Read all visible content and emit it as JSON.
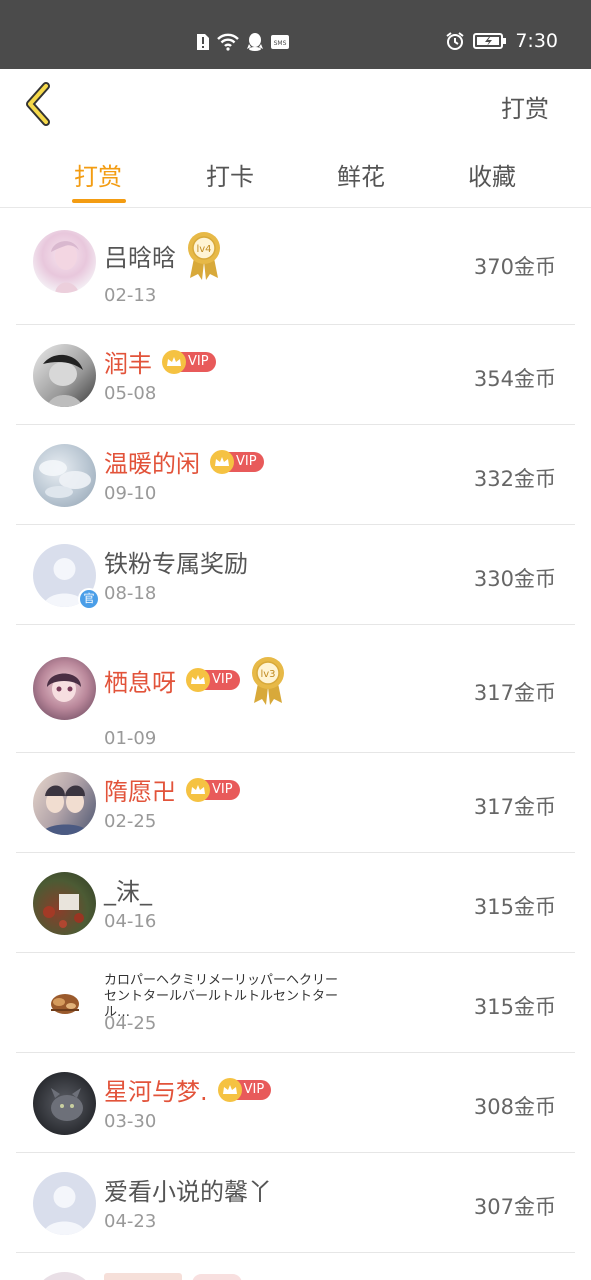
{
  "status_bar": {
    "time": "7:30",
    "left_icons": [
      "sim-alert-icon",
      "wifi-icon",
      "qq-icon",
      "sms-icon"
    ],
    "sms_text": "SMS",
    "right_icons": [
      "alarm-icon",
      "battery-icon"
    ]
  },
  "nav": {
    "back_icon": "chevron-left-icon",
    "action_label": "打赏"
  },
  "tabs": [
    {
      "label": "打赏",
      "active": true
    },
    {
      "label": "打卡",
      "active": false
    },
    {
      "label": "鲜花",
      "active": false
    },
    {
      "label": "收藏",
      "active": false
    }
  ],
  "badges": {
    "vip_label": "VIP",
    "official_label": "官"
  },
  "list": [
    {
      "name": "吕晗晗",
      "date": "02-13",
      "amount": "370金币",
      "vip": false,
      "medal": "lv4"
    },
    {
      "name": "润丰",
      "date": "05-08",
      "amount": "354金币",
      "vip": true,
      "medal": ""
    },
    {
      "name": "温暖的闲",
      "date": "09-10",
      "amount": "332金币",
      "vip": true,
      "medal": ""
    },
    {
      "name": "铁粉专属奖励",
      "date": "08-18",
      "amount": "330金币",
      "vip": false,
      "medal": "",
      "official": true
    },
    {
      "name": "栖息呀",
      "date": "01-09",
      "amount": "317金币",
      "vip": true,
      "medal": "lv3"
    },
    {
      "name": "隋愿卍",
      "date": "02-25",
      "amount": "317金币",
      "vip": true,
      "medal": ""
    },
    {
      "name": "_沫_",
      "date": "04-16",
      "amount": "315金币",
      "vip": false,
      "medal": ""
    },
    {
      "name": "カロパーヘクミリメーリッパーヘクリーセントタールバールトルトルセントタール…",
      "date": "04-25",
      "amount": "315金币",
      "vip": false,
      "medal": ""
    },
    {
      "name": "星河与梦.",
      "date": "03-30",
      "amount": "308金币",
      "vip": true,
      "medal": ""
    },
    {
      "name": "爱看小说的馨丫",
      "date": "04-23",
      "amount": "307金币",
      "vip": false,
      "medal": ""
    }
  ],
  "colors": {
    "accent": "#f39c12",
    "vip_name": "#e2533a",
    "vip_tag": "#e85a5a",
    "status_bar": "#4b4b4b"
  }
}
